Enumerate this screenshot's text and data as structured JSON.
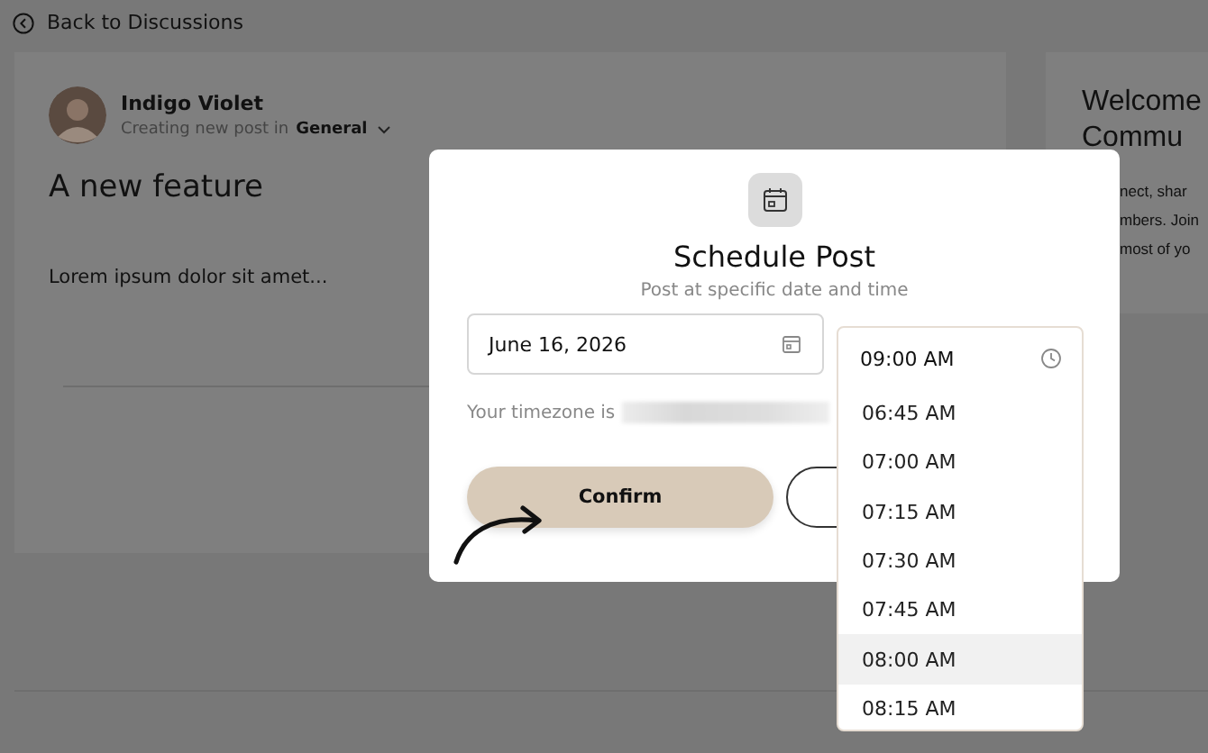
{
  "back_link": {
    "label": "Back to Discussions"
  },
  "post": {
    "author": "Indigo Violet",
    "context": "Creating new post in",
    "community": "General",
    "title": "A new feature",
    "body": "Lorem ipsum dolor sit amet..."
  },
  "welcome_card": {
    "heading": [
      "Welcome",
      "Commu"
    ],
    "lines": [
      "nect, shar",
      "mbers. Join",
      "most of yo"
    ]
  },
  "modal": {
    "title": "Schedule Post",
    "subtitle": "Post at specific date and time",
    "date": "June 16, 2026",
    "time": "09:00 AM",
    "timezone_label": "Your timezone is",
    "confirm": "Confirm"
  },
  "time_options": [
    {
      "label": "06:45 AM",
      "selected": false
    },
    {
      "label": "07:00 AM",
      "selected": false
    },
    {
      "label": "07:15 AM",
      "selected": false
    },
    {
      "label": "07:30 AM",
      "selected": false
    },
    {
      "label": "07:45 AM",
      "selected": false
    },
    {
      "label": "08:00 AM",
      "selected": true
    },
    {
      "label": "08:15 AM",
      "selected": false
    }
  ]
}
